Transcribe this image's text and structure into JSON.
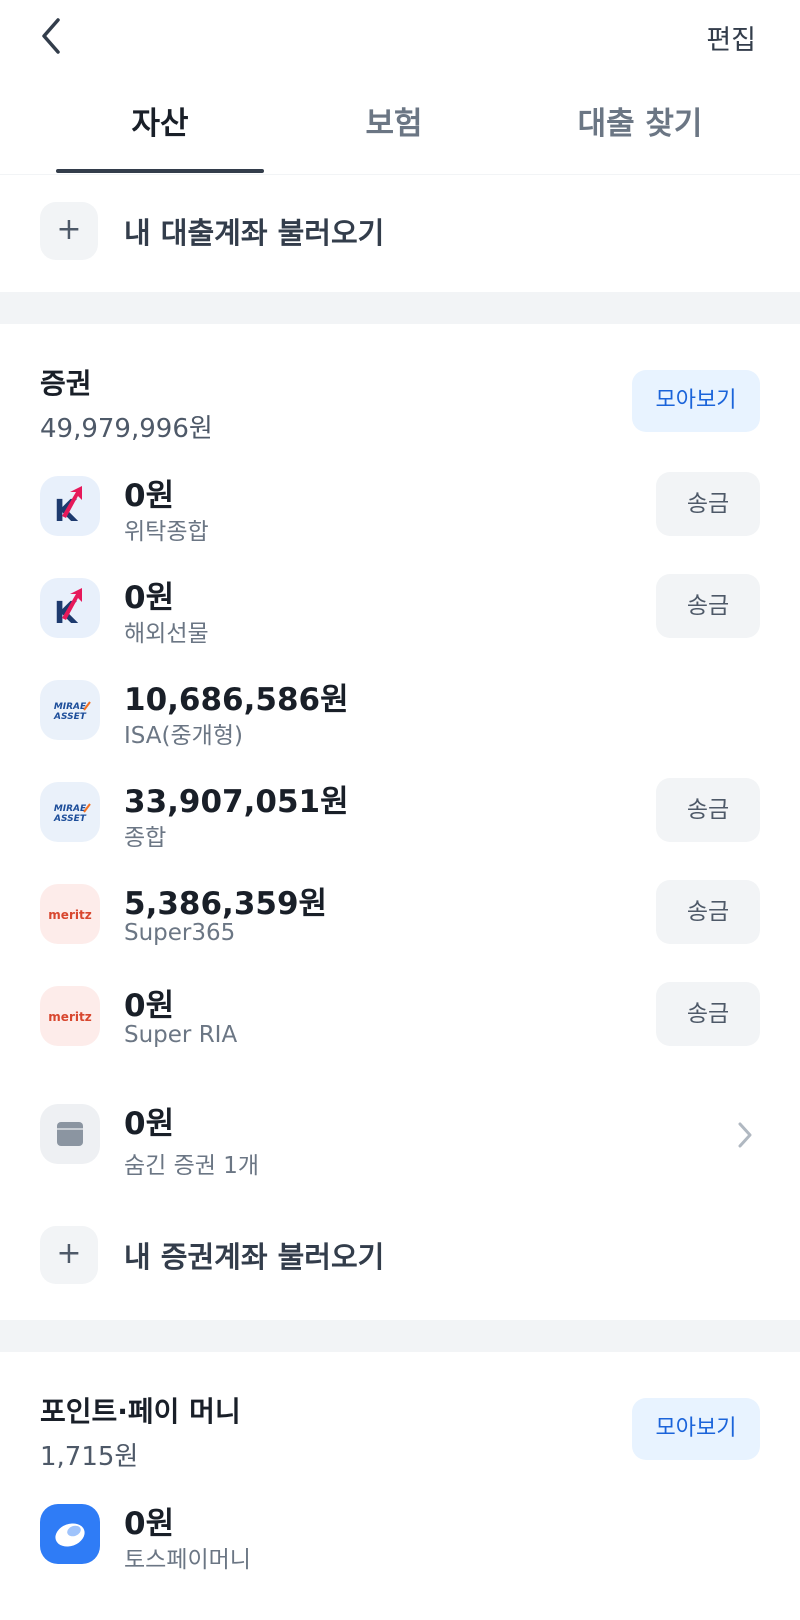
{
  "header": {
    "edit_label": "편집"
  },
  "tabs": [
    {
      "label": "자산",
      "active": true
    },
    {
      "label": "보험",
      "active": false
    },
    {
      "label": "대출 찾기",
      "active": false
    }
  ],
  "loan_import": {
    "icon": "plus-icon",
    "label": "내 대출계좌 불러오기"
  },
  "securities": {
    "title": "증권",
    "total": "49,979,996원",
    "collect_label": "모아보기",
    "accounts": [
      {
        "amount": "0원",
        "name": "위탁종합",
        "logo": "kiwoom",
        "send_label": "송금"
      },
      {
        "amount": "0원",
        "name": "해외선물",
        "logo": "kiwoom",
        "send_label": "송금"
      },
      {
        "amount": "10,686,586원",
        "name": "ISA(중개형)",
        "logo": "mirae",
        "logo_text": [
          "MIRAE",
          "ASSET"
        ]
      },
      {
        "amount": "33,907,051원",
        "name": "종합",
        "logo": "mirae",
        "logo_text": [
          "MIRAE",
          "ASSET"
        ],
        "send_label": "송금"
      },
      {
        "amount": "5,386,359원",
        "name": "Super365",
        "logo": "meritz",
        "logo_text": "meritz",
        "send_label": "송금"
      },
      {
        "amount": "0원",
        "name": "Super RIA",
        "logo": "meritz",
        "logo_text": "meritz",
        "send_label": "송금"
      }
    ],
    "hidden": {
      "amount": "0원",
      "label": "숨긴 증권 1개",
      "icon": "chevron-right-icon"
    },
    "import": {
      "icon": "plus-icon",
      "label": "내 증권계좌 불러오기"
    }
  },
  "points": {
    "title": "포인트·페이 머니",
    "total": "1,715원",
    "collect_label": "모아보기",
    "accounts": [
      {
        "amount": "0원",
        "name": "토스페이머니",
        "logo": "toss"
      }
    ]
  },
  "colors": {
    "primary_text": "#191f28",
    "secondary_text": "#6b7684",
    "accent_blue": "#1b64da",
    "accent_blue_bg": "#e8f3ff",
    "button_gray_bg": "#f2f4f6",
    "kiwoom_pink": "#e6195a",
    "kiwoom_navy": "#1d3a6e",
    "meritz_red": "#d8472f",
    "toss_blue": "#2f7cf6"
  }
}
